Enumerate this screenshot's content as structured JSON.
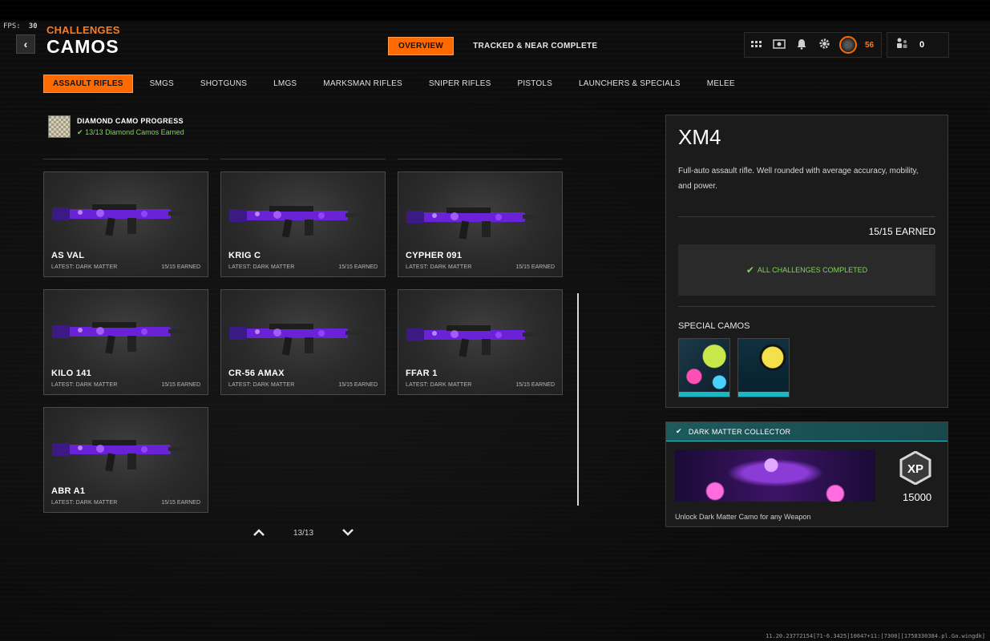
{
  "fps": {
    "label": "FPS:",
    "value": "30"
  },
  "header": {
    "breadcrumb": "CHALLENGES",
    "title": "CAMOS"
  },
  "top_tabs": [
    {
      "label": "OVERVIEW",
      "active": true
    },
    {
      "label": "TRACKED & NEAR COMPLETE",
      "active": false
    }
  ],
  "hud": {
    "level": "56",
    "currency": "0"
  },
  "categories": [
    {
      "label": "ASSAULT RIFLES",
      "active": true
    },
    {
      "label": "SMGS"
    },
    {
      "label": "SHOTGUNS"
    },
    {
      "label": "LMGS"
    },
    {
      "label": "MARKSMAN RIFLES"
    },
    {
      "label": "SNIPER RIFLES"
    },
    {
      "label": "PISTOLS"
    },
    {
      "label": "LAUNCHERS & SPECIALS"
    },
    {
      "label": "MELEE"
    }
  ],
  "diamond_progress": {
    "title": "DIAMOND CAMO PROGRESS",
    "status": "13/13 Diamond Camos Earned"
  },
  "weapons": [
    {
      "name": "AS VAL",
      "latest": "LATEST: DARK MATTER",
      "earned": "15/15 EARNED"
    },
    {
      "name": "KRIG C",
      "latest": "LATEST: DARK MATTER",
      "earned": "15/15 EARNED"
    },
    {
      "name": "CYPHER 091",
      "latest": "LATEST: DARK MATTER",
      "earned": "15/15 EARNED"
    },
    {
      "name": "KILO 141",
      "latest": "LATEST: DARK MATTER",
      "earned": "15/15 EARNED"
    },
    {
      "name": "CR-56 AMAX",
      "latest": "LATEST: DARK MATTER",
      "earned": "15/15 EARNED"
    },
    {
      "name": "FFAR 1",
      "latest": "LATEST: DARK MATTER",
      "earned": "15/15 EARNED"
    },
    {
      "name": "ABR A1",
      "latest": "LATEST: DARK MATTER",
      "earned": "15/15 EARNED"
    }
  ],
  "pager": {
    "label": "13/13"
  },
  "detail": {
    "weapon_name": "XM4",
    "description": "Full-auto assault rifle.  Well rounded with average accuracy, mobility, and power.",
    "earned": "15/15 EARNED",
    "completed_text": "ALL CHALLENGES COMPLETED",
    "special_camos_title": "SPECIAL CAMOS"
  },
  "reward": {
    "title": "DARK MATTER COLLECTOR",
    "xp_amount": "15000",
    "description": "Unlock Dark Matter Camo for any Weapon"
  },
  "build_string": "11.20.23772154[71-6.3425]10647+11:[7300][1758330384.pl.Ga.wingdk]",
  "colors": {
    "accent": "#ff6a00",
    "success": "#7fd65a",
    "teal": "#1d5a5e",
    "camo_purple": "#6a22d8"
  }
}
